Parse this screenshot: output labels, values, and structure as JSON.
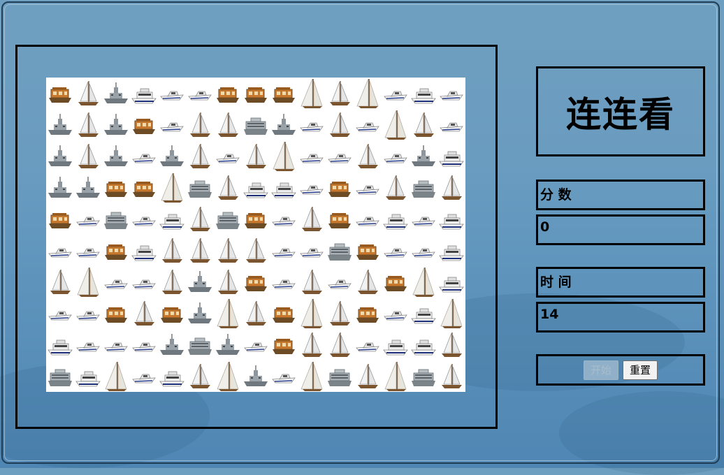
{
  "title": "连连看",
  "score": {
    "label": "分 数",
    "value": "0"
  },
  "time": {
    "label": "时 间",
    "value": "14"
  },
  "buttons": {
    "start": "开始",
    "reset": "重置"
  },
  "tile_types": [
    "orange-boat",
    "sailboat",
    "gray-warship",
    "white-yacht",
    "speedboat",
    "big-sail",
    "gray-ship"
  ],
  "grid": [
    [
      "orange-boat",
      "sailboat",
      "gray-warship",
      "white-yacht",
      "speedboat",
      "speedboat",
      "orange-boat",
      "orange-boat",
      "orange-boat",
      "big-sail",
      "sailboat",
      "big-sail",
      "speedboat",
      "white-yacht",
      "speedboat"
    ],
    [
      "gray-warship",
      "sailboat",
      "gray-warship",
      "orange-boat",
      "speedboat",
      "sailboat",
      "sailboat",
      "gray-ship",
      "gray-warship",
      "speedboat",
      "sailboat",
      "speedboat",
      "big-sail",
      "sailboat",
      "speedboat"
    ],
    [
      "gray-warship",
      "sailboat",
      "gray-warship",
      "speedboat",
      "gray-warship",
      "sailboat",
      "speedboat",
      "sailboat",
      "big-sail",
      "speedboat",
      "speedboat",
      "sailboat",
      "speedboat",
      "gray-warship",
      "white-yacht"
    ],
    [
      "gray-warship",
      "gray-warship",
      "orange-boat",
      "orange-boat",
      "big-sail",
      "gray-ship",
      "sailboat",
      "white-yacht",
      "white-yacht",
      "speedboat",
      "orange-boat",
      "speedboat",
      "sailboat",
      "gray-ship",
      "sailboat"
    ],
    [
      "orange-boat",
      "speedboat",
      "gray-ship",
      "speedboat",
      "white-yacht",
      "sailboat",
      "gray-ship",
      "orange-boat",
      "speedboat",
      "sailboat",
      "orange-boat",
      "speedboat",
      "white-yacht",
      "speedboat",
      "white-yacht"
    ],
    [
      "speedboat",
      "speedboat",
      "orange-boat",
      "white-yacht",
      "sailboat",
      "sailboat",
      "sailboat",
      "sailboat",
      "speedboat",
      "speedboat",
      "gray-ship",
      "orange-boat",
      "speedboat",
      "speedboat",
      "white-yacht"
    ],
    [
      "sailboat",
      "big-sail",
      "speedboat",
      "speedboat",
      "sailboat",
      "gray-warship",
      "sailboat",
      "orange-boat",
      "speedboat",
      "sailboat",
      "speedboat",
      "sailboat",
      "orange-boat",
      "big-sail",
      "white-yacht"
    ],
    [
      "speedboat",
      "speedboat",
      "orange-boat",
      "sailboat",
      "orange-boat",
      "gray-warship",
      "big-sail",
      "sailboat",
      "orange-boat",
      "big-sail",
      "sailboat",
      "orange-boat",
      "speedboat",
      "white-yacht",
      "big-sail"
    ],
    [
      "white-yacht",
      "speedboat",
      "speedboat",
      "speedboat",
      "gray-warship",
      "gray-ship",
      "gray-warship",
      "speedboat",
      "orange-boat",
      "sailboat",
      "sailboat",
      "speedboat",
      "white-yacht",
      "white-yacht",
      "sailboat"
    ],
    [
      "gray-ship",
      "white-yacht",
      "big-sail",
      "speedboat",
      "white-yacht",
      "sailboat",
      "big-sail",
      "gray-warship",
      "speedboat",
      "big-sail",
      "gray-ship",
      "sailboat",
      "big-sail",
      "gray-ship",
      "sailboat"
    ]
  ],
  "colors": {
    "background": "#6a9cc0",
    "border": "#000000",
    "board": "#ffffff",
    "boat_orange": "#c8782c",
    "boat_gray": "#8d969c"
  }
}
